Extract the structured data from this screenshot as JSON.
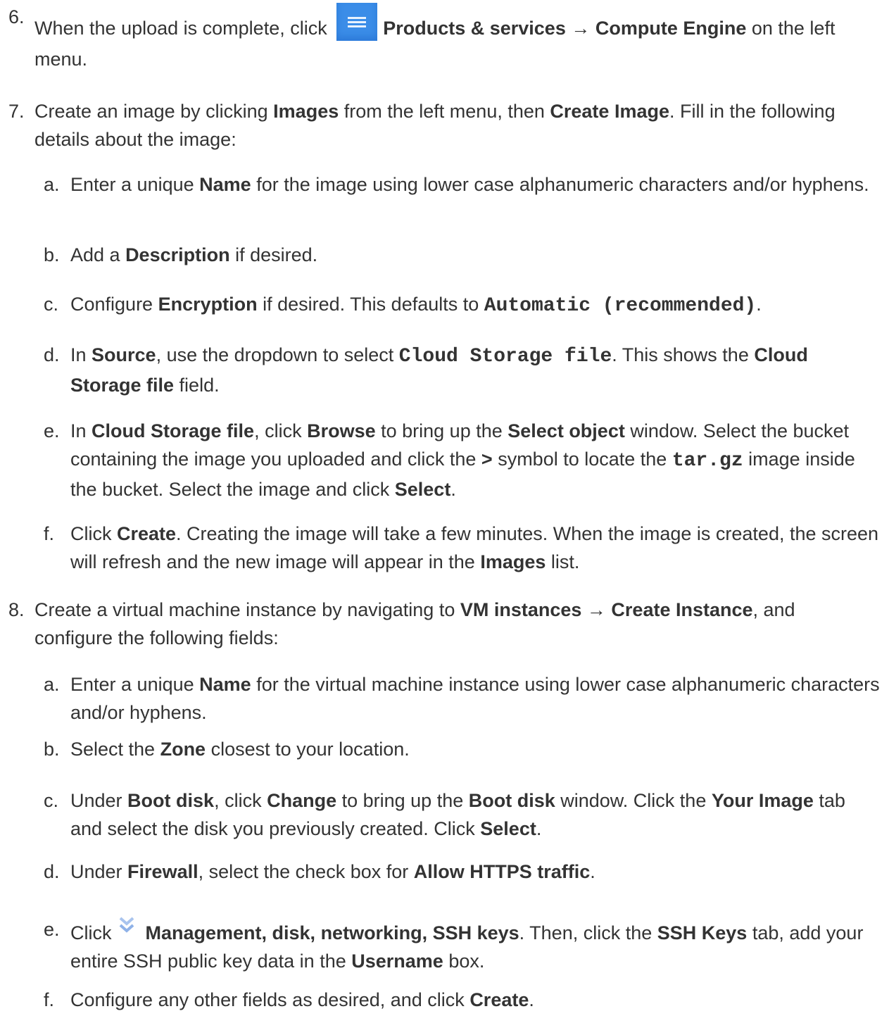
{
  "step6": {
    "num": "6.",
    "t1": "When the upload is complete, click ",
    "b1": "Products & services",
    "t2": " → ",
    "b2": "Compute Engine",
    "t3": " on the left menu.",
    "icon": "hamburger-menu-icon"
  },
  "step7": {
    "num": "7.",
    "t1": "Create an image by clicking ",
    "b1": "Images",
    "t2": " from the left menu, then ",
    "b2": "Create Image",
    "t3": ". Fill in the following details about the image:",
    "a": {
      "let": "a.",
      "t1": "Enter a unique ",
      "b1": "Name",
      "t2": " for the image using lower case alphanumeric characters and/or hyphens."
    },
    "b": {
      "let": "b.",
      "t1": "Add a ",
      "b1": "Description",
      "t2": " if desired."
    },
    "c": {
      "let": "c.",
      "t1": "Configure ",
      "b1": "Encryption",
      "t2": " if desired. This defaults to ",
      "code1": "Automatic (recommended)",
      "t3": "."
    },
    "d": {
      "let": "d.",
      "t1": "In ",
      "b1": "Source",
      "t2": ", use the dropdown to select ",
      "code1": "Cloud Storage file",
      "t3": ". This shows the ",
      "b2": "Cloud Storage file",
      "t4": " field."
    },
    "e": {
      "let": "e.",
      "t1": "In ",
      "b1": "Cloud Storage file",
      "t2": ", click ",
      "b2": "Browse",
      "t3": " to bring up the ",
      "b3": "Select object",
      "t4": " window. Select the bucket containing the image you uploaded and click the ",
      "b4": ">",
      "t5": " symbol to locate the ",
      "code1": "tar.gz",
      "t6": " image inside the bucket. Select the image and click ",
      "b5": "Select",
      "t7": "."
    },
    "f": {
      "let": "f.",
      "t1": "Click ",
      "b1": "Create",
      "t2": ". Creating the image will take a few minutes. When the image is created, the screen will refresh and the new image will appear in the ",
      "b2": "Images",
      "t3": " list."
    }
  },
  "step8": {
    "num": "8.",
    "t1": "Create a virtual machine instance by navigating to ",
    "b1": "VM instances",
    "t2": " → ",
    "b2": "Create Instance",
    "t3": ", and configure the following fields:",
    "a": {
      "let": "a.",
      "t1": "Enter a unique ",
      "b1": "Name",
      "t2": " for the virtual machine instance using lower case alphanumeric characters and/or hyphens."
    },
    "b": {
      "let": "b.",
      "t1": "Select the ",
      "b1": "Zone",
      "t2": " closest to your location."
    },
    "c": {
      "let": "c.",
      "t1": "Under ",
      "b1": "Boot disk",
      "t2": ", click ",
      "b2": "Change",
      "t3": " to bring up the ",
      "b3": "Boot disk",
      "t4": " window. Click the ",
      "b4": "Your Image",
      "t5": " tab and select the disk you previously created. Click ",
      "b5": "Select",
      "t6": "."
    },
    "d": {
      "let": "d.",
      "t1": "Under ",
      "b1": "Firewall",
      "t2": ", select the check box for ",
      "b2": "Allow HTTPS traffic",
      "t3": "."
    },
    "e": {
      "let": "e.",
      "t1": "Click",
      "b1": "Management, disk, networking, SSH keys",
      "t2": ". Then, click the ",
      "b2": "SSH Keys",
      "t3": " tab, add your entire SSH public key data in the ",
      "b3": "Username",
      "t4": " box.",
      "icon": "double-chevron-down-icon"
    },
    "f": {
      "let": "f.",
      "t1": "Configure any other fields as desired, and click ",
      "b1": "Create",
      "t2": "."
    }
  }
}
